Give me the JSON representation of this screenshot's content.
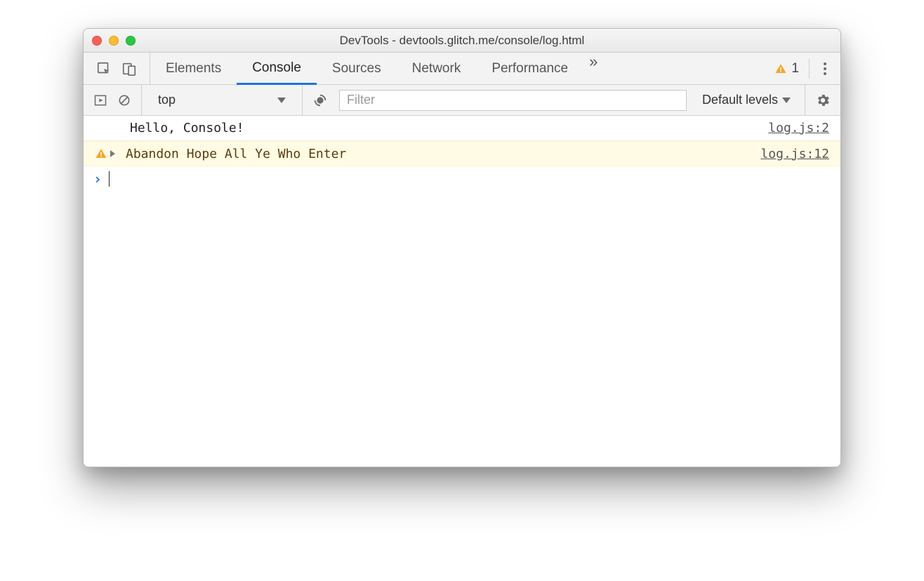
{
  "window": {
    "title": "DevTools - devtools.glitch.me/console/log.html"
  },
  "tabs": {
    "elements": "Elements",
    "console": "Console",
    "sources": "Sources",
    "network": "Network",
    "performance": "Performance"
  },
  "issues": {
    "warnings": "1"
  },
  "filterbar": {
    "context": "top",
    "filter_placeholder": "Filter",
    "levels_label": "Default levels"
  },
  "console": {
    "rows": [
      {
        "type": "log",
        "message": "Hello, Console!",
        "source": "log.js:2"
      },
      {
        "type": "warn",
        "message": "Abandon Hope All Ye Who Enter",
        "source": "log.js:12"
      }
    ]
  }
}
